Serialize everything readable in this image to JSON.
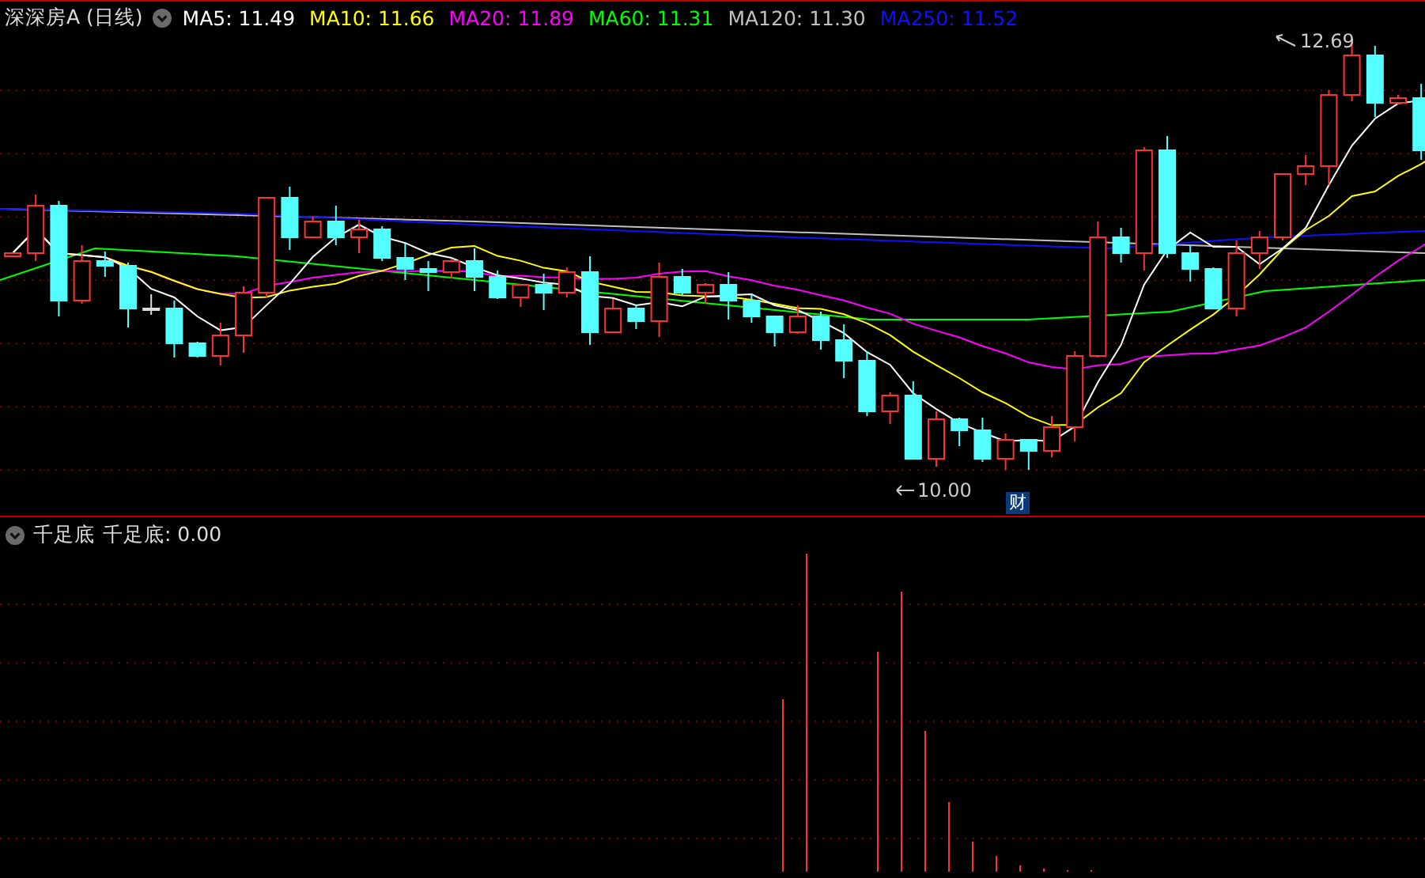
{
  "header": {
    "title": "深深房A (日线)",
    "ma": [
      {
        "label": "MA5: 11.49",
        "color": "#ffffff"
      },
      {
        "label": "MA10: 11.66",
        "color": "#ffff00"
      },
      {
        "label": "MA20: 11.89",
        "color": "#ff00ff"
      },
      {
        "label": "MA60: 11.31",
        "color": "#00ff00"
      },
      {
        "label": "MA120: 11.30",
        "color": "#c0c0c0"
      },
      {
        "label": "MA250: 11.52",
        "color": "#1010ff"
      }
    ]
  },
  "main_chart": {
    "high_label": "12.69",
    "low_label": "10.00",
    "event_badge": "财"
  },
  "indicator": {
    "name": "千足底",
    "reading": "千足底: 0.00"
  }
}
